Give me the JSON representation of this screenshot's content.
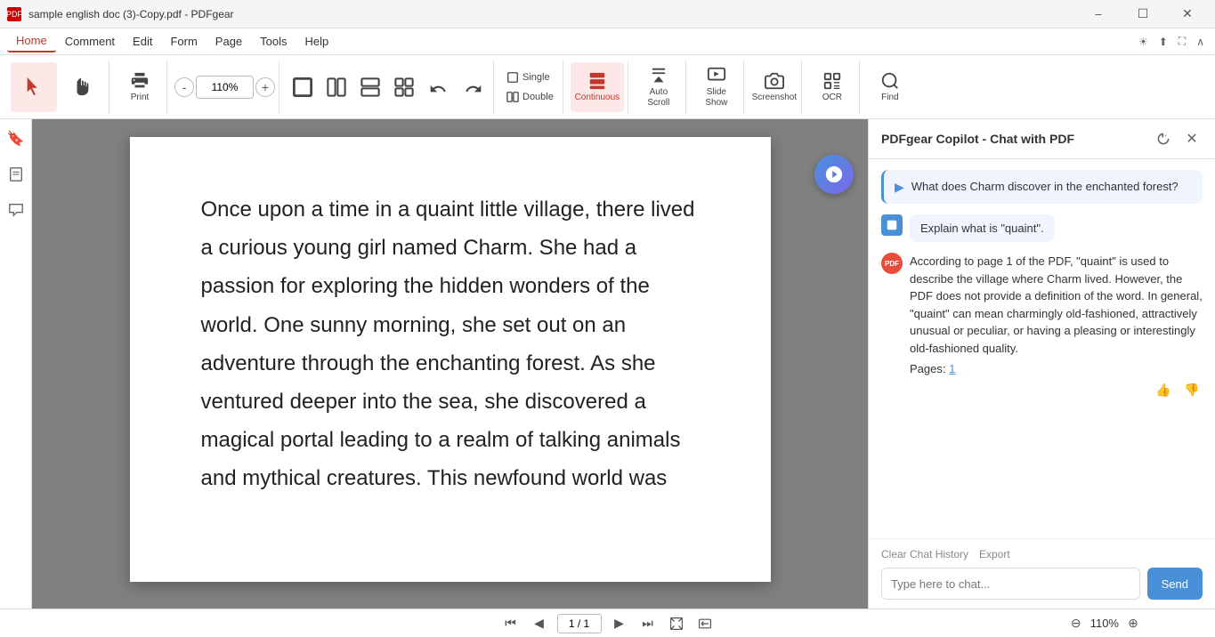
{
  "titleBar": {
    "title": "sample english doc (3)-Copy.pdf - PDFgear",
    "appIcon": "PDF",
    "controls": [
      "minimize",
      "maximize",
      "close"
    ]
  },
  "menuBar": {
    "items": [
      "Home",
      "Comment",
      "Edit",
      "Form",
      "Page",
      "Tools",
      "Help"
    ],
    "activeItem": "Home",
    "rightIcons": [
      "sun-icon",
      "export-icon",
      "fullscreen-icon",
      "collapse-icon"
    ]
  },
  "toolbar": {
    "cursorBtn": {
      "label": ""
    },
    "handBtn": {
      "label": ""
    },
    "printBtn": {
      "label": "Print"
    },
    "zoomOut": "-",
    "zoomIn": "+",
    "zoomLevel": "110%",
    "gridBtns": [
      "grid1",
      "grid2",
      "grid3",
      "grid4"
    ],
    "undoBtn": "↩",
    "redoBtn": "↪",
    "singleLabel": "Single",
    "doubleLabel": "Double",
    "continuousLabel": "Continuous",
    "autoScrollLabel": "Auto Scroll",
    "slideShowLabel": "Slide Show",
    "screenshotLabel": "Screenshot",
    "ocrLabel": "OCR",
    "findLabel": "Find"
  },
  "leftSidebar": {
    "items": [
      "bookmark-icon",
      "pages-icon",
      "comments-icon"
    ]
  },
  "pdfContent": {
    "text": "Once upon a time in a quaint little village, there lived a curious young girl named Charm. She had a passion for exploring the hidden wonders of the world. One sunny morning, she set out on an adventure through the enchanting forest. As she ventured deeper into the sea, she discovered a magical portal leading to a realm of talking animals and mythical creatures. This newfound world was"
  },
  "bottomBar": {
    "pageDisplay": "1 / 1",
    "zoomLevel": "110%"
  },
  "copilot": {
    "title": "PDFgear Copilot - Chat with PDF",
    "suggestedQuestion": "What does Charm discover in the enchanted forest?",
    "userMessage": "Explain what is \"quaint\".",
    "aiResponse": "According to page 1 of the PDF, \"quaint\" is used to describe the village where Charm lived. However, the PDF does not provide a definition of the word. In general, \"quaint\" can mean charmingly old-fashioned, attractively unusual or peculiar, or having a pleasing or interestingly old-fashioned quality.",
    "pagesLabel": "Pages:",
    "pagesLink": "1",
    "clearHistory": "Clear Chat History",
    "export": "Export",
    "inputPlaceholder": "Type here to chat...",
    "sendLabel": "Send"
  }
}
